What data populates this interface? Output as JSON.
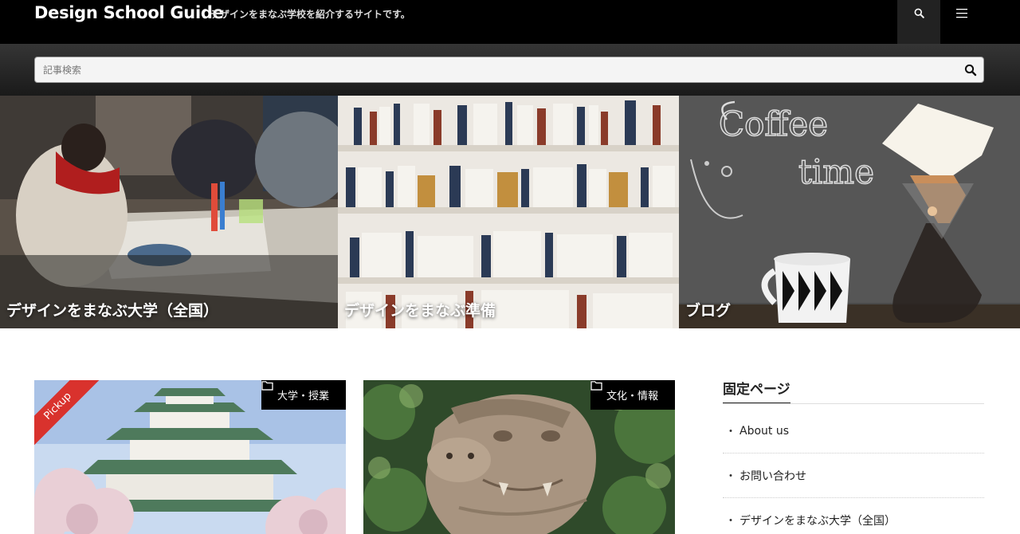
{
  "header": {
    "site_title": "Design School Guide",
    "tagline": "デザインをまなぶ学校を紹介するサイトです。"
  },
  "search": {
    "placeholder": "記事検索"
  },
  "hero_tiles": [
    {
      "label": "デザインをまなぶ大学（全国）"
    },
    {
      "label": "デザインをまなぶ準備"
    },
    {
      "label": "ブログ"
    }
  ],
  "cards": [
    {
      "category": "大学・授業",
      "ribbon": "Pickup"
    },
    {
      "category": "文化・情報"
    }
  ],
  "sidebar": {
    "title": "固定ページ",
    "bullet": "・",
    "items": [
      {
        "label": "About us"
      },
      {
        "label": "お問い合わせ"
      },
      {
        "label": "デザインをまなぶ大学（全国）"
      }
    ]
  },
  "colors": {
    "header_bg": "#000000",
    "pickup_ribbon": "#d9322d",
    "badge_bg": "#000000"
  }
}
